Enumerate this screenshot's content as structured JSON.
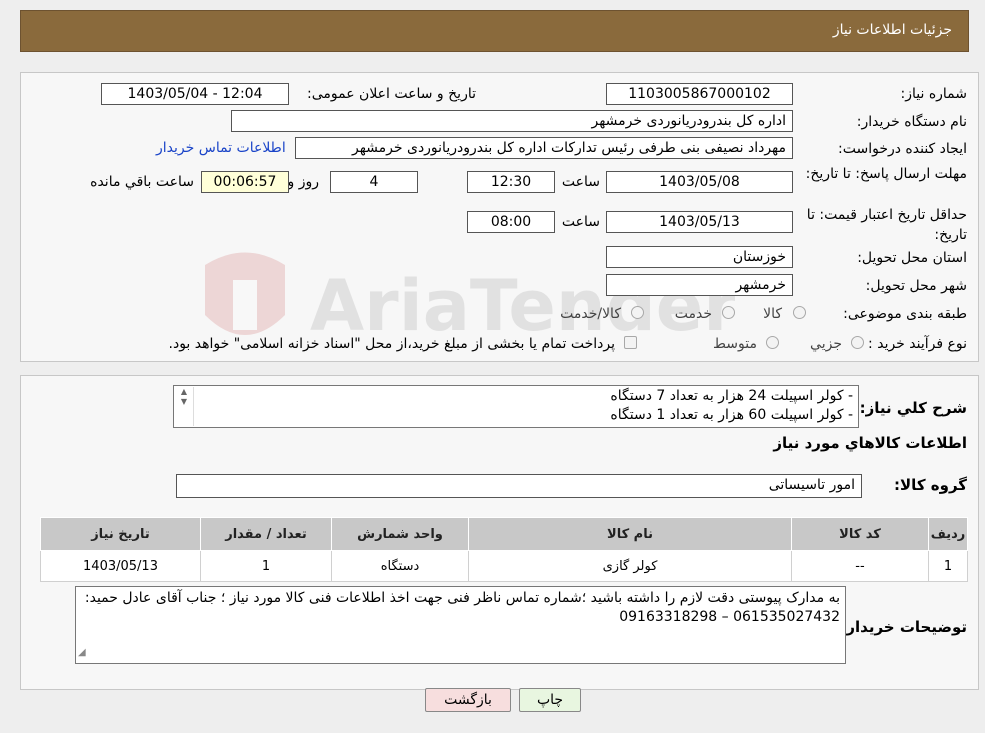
{
  "header": {
    "title": "جزئیات اطلاعات نیاز"
  },
  "form": {
    "need_number_label": "شماره نیاز:",
    "need_number": "1103005867000102",
    "announce_label": "تاریخ و ساعت اعلان عمومی:",
    "announce_value": "1403/05/04 - 12:04",
    "buyer_org_label": "نام دستگاه خریدار:",
    "buyer_org": "اداره کل بندرودریانوردی خرمشهر",
    "creator_label": "ایجاد کننده درخواست:",
    "creator": "مهرداد  نصیفی بنی طرفی رئیس تدارکات اداره کل بندرودریانوردی خرمشهر",
    "buyer_contact_link": "اطلاعات تماس خریدار",
    "reply_deadline_label": "مهلت ارسال پاسخ: تا تاریخ:",
    "reply_date": "1403/05/08",
    "time_label": "ساعت",
    "reply_time": "12:30",
    "days": "4",
    "days_label": "روز و",
    "remaining": "00:06:57",
    "remaining_label": "ساعت باقي مانده",
    "price_valid_label": "حداقل تاریخ اعتبار قیمت: تا تاریخ:",
    "price_valid_date": "1403/05/13",
    "price_valid_time": "08:00",
    "province_label": "استان محل تحویل:",
    "province": "خوزستان",
    "city_label": "شهر محل تحویل:",
    "city": "خرمشهر",
    "category_label": "طبقه بندی موضوعی:",
    "category_options": [
      "کالا",
      "خدمت",
      "کالا/خدمت"
    ],
    "process_label": "نوع فرآیند خرید :",
    "process_options": [
      "جزيي",
      "متوسط"
    ],
    "process_note": "پرداخت تمام یا بخشی از مبلغ خرید،از محل \"اسناد خزانه اسلامی\" خواهد بود."
  },
  "description": {
    "label": "شرح کلي نياز:",
    "lines": [
      "- کولر اسپیلت 24 هزار به تعداد 7 دستگاه",
      "- کولر اسپیلت 60 هزار به تعداد 1 دستگاه"
    ],
    "goods_info_label": "اطلاعات کالاهاي مورد نياز",
    "group_label": "گروه کالا:",
    "group_value": "امور تاسیساتی"
  },
  "table": {
    "headers": [
      "رديف",
      "کد کالا",
      "نام کالا",
      "واحد شمارش",
      "تعداد / مقدار",
      "تاریخ نیاز"
    ],
    "rows": [
      [
        "1",
        "--",
        "کولر گازی",
        "دستگاه",
        "1",
        "1403/05/13"
      ]
    ]
  },
  "notes": {
    "label": "توضيحات خريدار:",
    "text": "به مدارک پیوستی دقت لازم را داشته باشید ؛شماره تماس ناظر فنی جهت اخذ اطلاعات فنی کالا مورد نیاز ؛ جناب آقای عادل حمید: 061535027432 – 09163318298"
  },
  "buttons": {
    "print": "چاپ",
    "back": "بازگشت"
  },
  "watermark": {
    "text": "AriaTender.neT"
  },
  "colors": {
    "header_bg": "#8a6a3c",
    "link": "#1a44c8",
    "back_button_bg": "#f7dede",
    "print_button_bg": "#e8f6e0"
  }
}
